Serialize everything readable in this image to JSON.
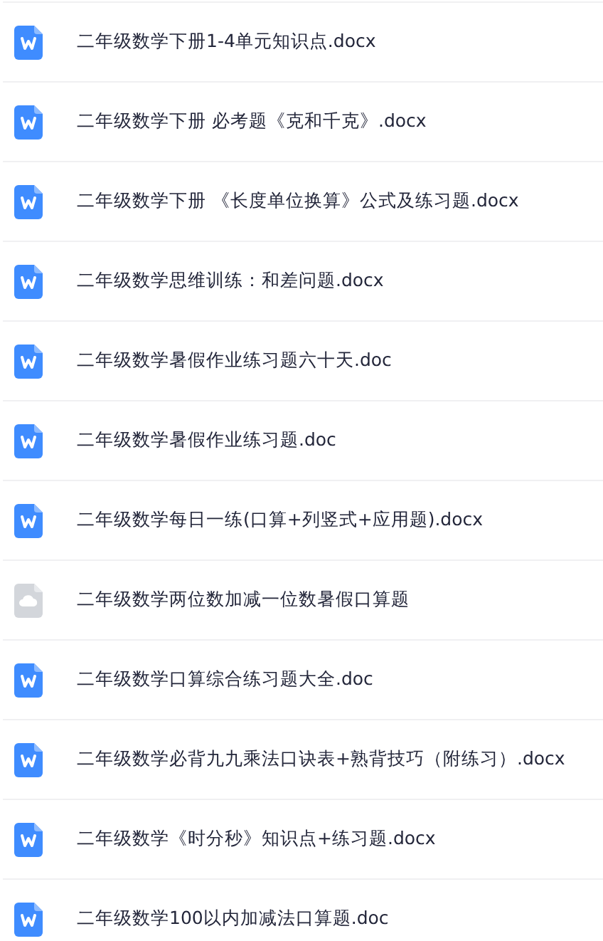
{
  "files": [
    {
      "kind": "word",
      "name": "二年级数学下册1-4单元知识点.docx"
    },
    {
      "kind": "word",
      "name": "二年级数学下册 必考题《克和千克》.docx"
    },
    {
      "kind": "word",
      "name": "二年级数学下册 《长度单位换算》公式及练习题.docx"
    },
    {
      "kind": "word",
      "name": "二年级数学思维训练：和差问题.docx"
    },
    {
      "kind": "word",
      "name": "二年级数学暑假作业练习题六十天.doc"
    },
    {
      "kind": "word",
      "name": "二年级数学暑假作业练习题.doc"
    },
    {
      "kind": "word",
      "name": "二年级数学每日一练(口算+列竖式+应用题).docx"
    },
    {
      "kind": "cloud",
      "name": "二年级数学两位数加减一位数暑假口算题"
    },
    {
      "kind": "word",
      "name": "二年级数学口算综合练习题大全.doc"
    },
    {
      "kind": "word",
      "name": "二年级数学必背九九乘法口诀表+熟背技巧（附练习）.docx"
    },
    {
      "kind": "word",
      "name": "二年级数学《时分秒》知识点+练习题.docx"
    },
    {
      "kind": "word",
      "name": "二年级数学100以内加减法口算题.doc"
    }
  ]
}
